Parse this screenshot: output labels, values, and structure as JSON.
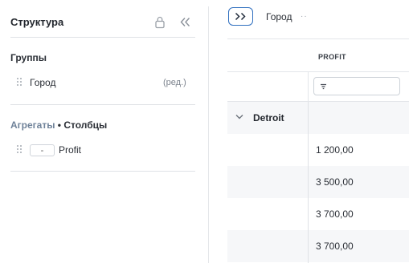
{
  "panel": {
    "title": "Структура",
    "groups_title": "Группы",
    "group_items": [
      {
        "label": "Город",
        "edit": "(ред.)"
      }
    ],
    "aggregates_title": "Агрегаты",
    "aggregates_sep": " • ",
    "columns_title": "Столбцы",
    "aggregate_items": [
      {
        "func": "-",
        "label": "Profit"
      }
    ]
  },
  "toolbar": {
    "group_chip": "Город",
    "group_chip_more": "··"
  },
  "grid": {
    "column_header": "PROFIT",
    "group_row": {
      "label": "Detroit"
    },
    "rows": [
      "1 200,00",
      "3 500,00",
      "3 700,00",
      "3 700,00"
    ]
  },
  "colors": {
    "accent": "#2f6fbf",
    "row_band": "#f6f7f9",
    "muted_heading": "#6f8299"
  },
  "icons": [
    "lock-icon",
    "collapse-left-icon",
    "expand-right-icon",
    "drag-handle-icon",
    "chevron-down-icon",
    "filter-icon"
  ]
}
